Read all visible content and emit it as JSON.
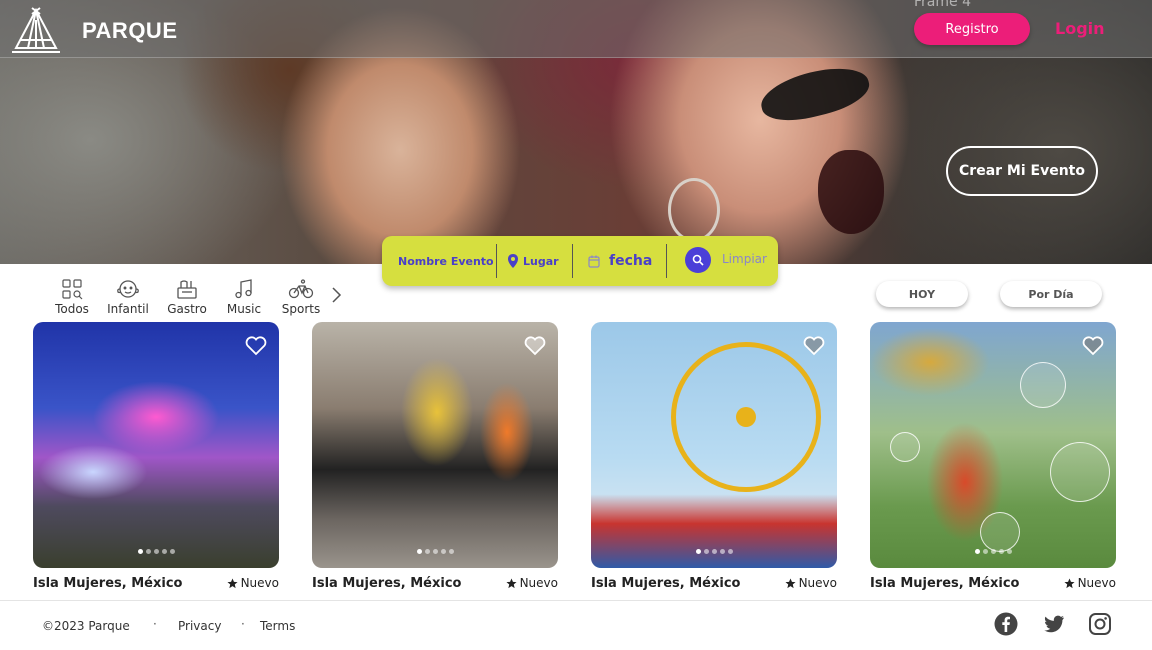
{
  "header": {
    "brand": "PARQUE",
    "frame_label": "Frame 4",
    "register_label": "Registro",
    "login_label": "Login",
    "create_event_label": "Crear Mi Evento"
  },
  "search": {
    "event_name_label": "Nombre Evento",
    "place_label": "Lugar",
    "date_label": "fecha",
    "clear_label": "Limpiar"
  },
  "categories": [
    {
      "label": "Todos",
      "icon": "grid-icon"
    },
    {
      "label": "Infantil",
      "icon": "baby-icon"
    },
    {
      "label": "Gastro",
      "icon": "food-icon"
    },
    {
      "label": "Music",
      "icon": "music-icon"
    },
    {
      "label": "Sports",
      "icon": "bike-icon"
    }
  ],
  "filters": {
    "today_label": "HOY",
    "by_day_label": "Por Día"
  },
  "cards": [
    {
      "location": "Isla Mujeres, México",
      "badge": "Nuevo",
      "image": "illuminated-building-concert"
    },
    {
      "location": "Isla Mujeres, México",
      "badge": "Nuevo",
      "image": "marathon-runners"
    },
    {
      "location": "Isla Mujeres, México",
      "badge": "Nuevo",
      "image": "ferris-wheel-fair"
    },
    {
      "location": "Isla Mujeres, México",
      "badge": "Nuevo",
      "image": "kids-bubbles-park"
    }
  ],
  "footer": {
    "copyright": "©2023 Parque",
    "privacy_label": "Privacy",
    "terms_label": "Terms",
    "social": [
      "facebook-icon",
      "twitter-icon",
      "instagram-icon"
    ]
  },
  "colors": {
    "accent_pink": "#ec1e79",
    "search_bar": "#d6df3f",
    "search_text": "#4a40c8"
  }
}
